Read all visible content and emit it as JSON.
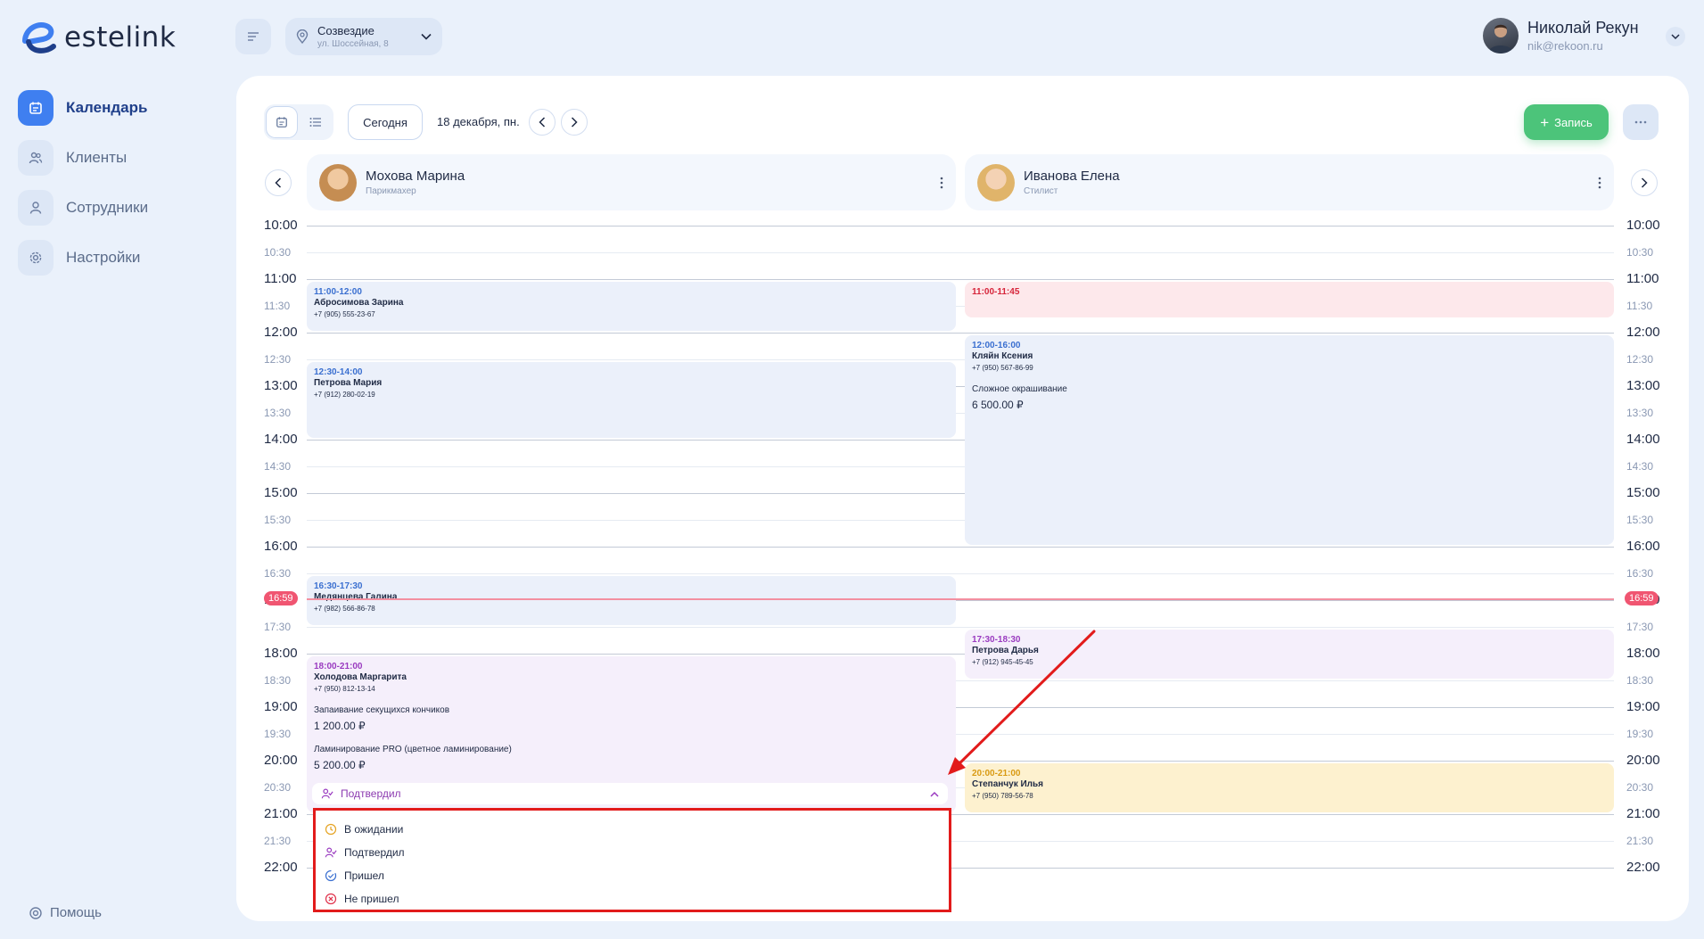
{
  "brand": {
    "name": "estelink"
  },
  "nav": [
    {
      "id": "calendar",
      "label": "Календарь",
      "active": true
    },
    {
      "id": "clients",
      "label": "Клиенты",
      "active": false
    },
    {
      "id": "staff",
      "label": "Сотрудники",
      "active": false
    },
    {
      "id": "settings",
      "label": "Настройки",
      "active": false
    }
  ],
  "help_label": "Помощь",
  "branch": {
    "name": "Созвездие",
    "address": "ул. Шоссейная, 8"
  },
  "user": {
    "name": "Николай Рекун",
    "email": "nik@rekoon.ru"
  },
  "toolbar": {
    "today_label": "Сегодня",
    "date_label": "18 декабря, пн.",
    "add_label": "Запись"
  },
  "staff": [
    {
      "name": "Мохова Марина",
      "role": "Парикмахер"
    },
    {
      "name": "Иванова Елена",
      "role": "Стилист"
    }
  ],
  "time_labels": [
    "10:00",
    "10:30",
    "11:00",
    "11:30",
    "12:00",
    "12:30",
    "13:00",
    "13:30",
    "14:00",
    "14:30",
    "15:00",
    "15:30",
    "16:00",
    "16:30",
    "17:00",
    "17:30",
    "18:00",
    "18:30",
    "19:00",
    "19:30",
    "20:00",
    "20:30",
    "21:00",
    "21:30",
    "22:00"
  ],
  "now_label": "16:59",
  "appointments": [
    {
      "staff": 0,
      "time": "11:00-12:00",
      "client": "Абросимова Зарина",
      "phone": "+7 (905) 555-23-67",
      "color": "#3a6fd0",
      "bg": "#ebf0fa"
    },
    {
      "staff": 0,
      "time": "12:30-14:00",
      "client": "Петрова Мария",
      "phone": "+7 (912) 280-02-19",
      "color": "#3a6fd0",
      "bg": "#ebf0fa"
    },
    {
      "staff": 0,
      "time": "16:30-17:30",
      "client": "Медянцева Галина",
      "phone": "+7 (982) 566-86-78",
      "color": "#3a6fd0",
      "bg": "#ebf0fa"
    },
    {
      "staff": 0,
      "time": "18:00-21:00",
      "client": "Холодова Маргарита",
      "phone": "+7 (950) 812-13-14",
      "color": "#9a3bc0",
      "bg": "#f5effb",
      "services": [
        {
          "name": "Запаивание секущихся кончиков",
          "price": "1 200.00 ₽"
        },
        {
          "name": "Ламинирование PRO (цветное ламинирование)",
          "price": "5 200.00 ₽"
        }
      ]
    },
    {
      "staff": 1,
      "time": "11:00-11:45",
      "client": "",
      "phone": "",
      "color": "#d6243a",
      "bg": "#fde8eb"
    },
    {
      "staff": 1,
      "time": "12:00-16:00",
      "client": "Кляйн Ксения",
      "phone": "+7 (950) 567-86-99",
      "color": "#3a6fd0",
      "bg": "#ebf0fa",
      "services": [
        {
          "name": "Сложное окрашивание",
          "price": "6 500.00 ₽"
        }
      ]
    },
    {
      "staff": 1,
      "time": "17:30-18:30",
      "client": "Петрова Дарья",
      "phone": "+7 (912) 945-45-45",
      "color": "#9a3bc0",
      "bg": "#f5effb"
    },
    {
      "staff": 1,
      "time": "20:00-21:00",
      "client": "Степанчук Илья",
      "phone": "+7 (950) 789-56-78",
      "color": "#d99a12",
      "bg": "#fdf1cf"
    }
  ],
  "status": {
    "current": "Подтвердил",
    "options": [
      {
        "label": "В ожидании",
        "icon": "clock-icon",
        "color": "#e5a323"
      },
      {
        "label": "Подтвердил",
        "icon": "user-check-icon",
        "color": "#9a3bc0"
      },
      {
        "label": "Пришел",
        "icon": "check-circle-icon",
        "color": "#3a6fd0"
      },
      {
        "label": "Не пришел",
        "icon": "x-circle-icon",
        "color": "#e0314b"
      }
    ]
  },
  "colors": {
    "accent": "#3f7ff0",
    "add_button": "#4cc47a",
    "now": "#f05571",
    "highlight": "#e21b1b"
  }
}
